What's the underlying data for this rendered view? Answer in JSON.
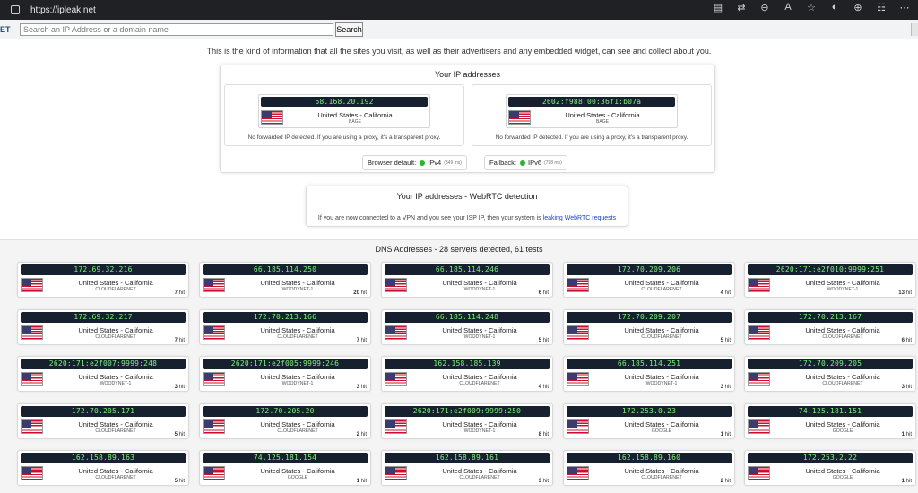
{
  "browser": {
    "url": "https://ipleak.net"
  },
  "site": {
    "brand": "ET",
    "search_placeholder": "Search an IP Address or a domain name",
    "search_button": "Search",
    "intro": "This is the kind of information that all the sites you visit, as well as their advertisers and any embedded widget, can see and collect about you."
  },
  "your_ip": {
    "title": "Your IP addresses",
    "items": [
      {
        "ip": "68.168.20.192",
        "location": "United States - California",
        "isp": "BAGE",
        "note": "No forwarded IP detected. If you are using a proxy, it's a transparent proxy."
      },
      {
        "ip": "2602:f988:00:36f1:b07a",
        "location": "United States - California",
        "isp": "BAGE",
        "note": "No forwarded IP detected. If you are using a proxy, it's a transparent proxy."
      }
    ],
    "browser_default_label": "Browser default:",
    "browser_default_proto": "IPv4",
    "browser_default_ms": "(349 ms)",
    "fallback_label": "Fallback:",
    "fallback_proto": "IPv6",
    "fallback_ms": "(798 ms)"
  },
  "webrtc": {
    "title": "Your IP addresses - WebRTC detection",
    "text": "If you are now connected to a VPN and you see your ISP IP, then your system is",
    "link": "leaking WebRTC requests"
  },
  "dns": {
    "title": "DNS Addresses - 28 servers detected, 61 tests",
    "hits_suffix": "hit",
    "servers": [
      {
        "ip": "172.69.32.216",
        "location": "United States - California",
        "isp": "CLOUDFLARENET",
        "hits": "7"
      },
      {
        "ip": "66.185.114.250",
        "location": "United States - California",
        "isp": "WOODYNET-1",
        "hits": "20"
      },
      {
        "ip": "66.185.114.246",
        "location": "United States - California",
        "isp": "WOODYNET-1",
        "hits": "6"
      },
      {
        "ip": "172.70.209.206",
        "location": "United States - California",
        "isp": "CLOUDFLARENET",
        "hits": "4"
      },
      {
        "ip": "2620:171:e2f010:9999:251",
        "location": "United States - California",
        "isp": "WOODYNET-1",
        "hits": "13"
      },
      {
        "ip": "172.69.32.217",
        "location": "United States - California",
        "isp": "CLOUDFLARENET",
        "hits": "7"
      },
      {
        "ip": "172.70.213.166",
        "location": "United States - California",
        "isp": "CLOUDFLARENET",
        "hits": "7"
      },
      {
        "ip": "66.185.114.248",
        "location": "United States - California",
        "isp": "WOODYNET-1",
        "hits": "5"
      },
      {
        "ip": "172.70.209.207",
        "location": "United States - California",
        "isp": "CLOUDFLARENET",
        "hits": "5"
      },
      {
        "ip": "172.70.213.167",
        "location": "United States - California",
        "isp": "CLOUDFLARENET",
        "hits": "6"
      },
      {
        "ip": "2620:171:e2f007:9999:248",
        "location": "United States - California",
        "isp": "WOODYNET-1",
        "hits": "3"
      },
      {
        "ip": "2620:171:e2f005:9999:246",
        "location": "United States - California",
        "isp": "WOODYNET-1",
        "hits": "3"
      },
      {
        "ip": "162.158.185.139",
        "location": "United States - California",
        "isp": "CLOUDFLARENET",
        "hits": "4"
      },
      {
        "ip": "66.185.114.251",
        "location": "United States - California",
        "isp": "WOODYNET-1",
        "hits": "3"
      },
      {
        "ip": "172.70.209.205",
        "location": "United States - California",
        "isp": "CLOUDFLARENET",
        "hits": "3"
      },
      {
        "ip": "172.70.205.171",
        "location": "United States - California",
        "isp": "CLOUDFLARENET",
        "hits": "5"
      },
      {
        "ip": "172.70.205.20",
        "location": "United States - California",
        "isp": "CLOUDFLARENET",
        "hits": "2"
      },
      {
        "ip": "2620:171:e2f009:9999:250",
        "location": "United States - California",
        "isp": "WOODYNET-1",
        "hits": "8"
      },
      {
        "ip": "172.253.0.23",
        "location": "United States - California",
        "isp": "GOOGLE",
        "hits": "1"
      },
      {
        "ip": "74.125.181.151",
        "location": "United States - California",
        "isp": "GOOGLE",
        "hits": "1"
      },
      {
        "ip": "162.158.89.163",
        "location": "United States - California",
        "isp": "CLOUDFLARENET",
        "hits": "5"
      },
      {
        "ip": "74.125.181.154",
        "location": "United States - California",
        "isp": "GOOGLE",
        "hits": "1"
      },
      {
        "ip": "162.158.89.161",
        "location": "United States - California",
        "isp": "CLOUDFLARENET",
        "hits": "3"
      },
      {
        "ip": "162.158.89.160",
        "location": "United States - California",
        "isp": "CLOUDFLARENET",
        "hits": "2"
      },
      {
        "ip": "172.253.2.22",
        "location": "United States - California",
        "isp": "GOOGLE",
        "hits": "1"
      }
    ]
  }
}
